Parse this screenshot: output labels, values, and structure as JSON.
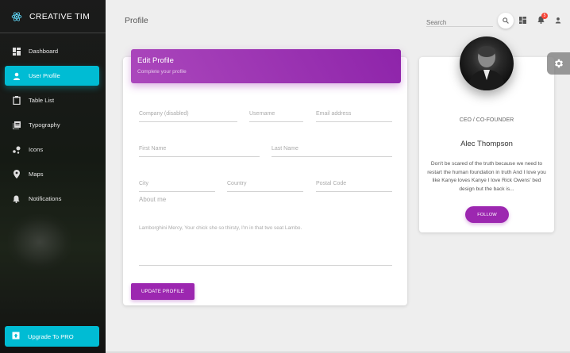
{
  "sidebar": {
    "brand": "CREATIVE TIM",
    "items": [
      {
        "label": "Dashboard",
        "icon": "dashboard-icon"
      },
      {
        "label": "User Profile",
        "icon": "person-icon",
        "active": true
      },
      {
        "label": "Table List",
        "icon": "clipboard-icon"
      },
      {
        "label": "Typography",
        "icon": "library-books-icon"
      },
      {
        "label": "Icons",
        "icon": "bubble-chart-icon"
      },
      {
        "label": "Maps",
        "icon": "location-pin-icon"
      },
      {
        "label": "Notifications",
        "icon": "bell-icon"
      }
    ],
    "upgrade_label": "Upgrade To PRO"
  },
  "topbar": {
    "title": "Profile",
    "search_placeholder": "Search",
    "notification_count": "5"
  },
  "edit_profile": {
    "title": "Edit Profile",
    "subtitle": "Complete your profile",
    "fields": {
      "company": "Company (disabled)",
      "username": "Username",
      "email": "Email address",
      "first_name": "First Name",
      "last_name": "Last Name",
      "city": "City",
      "country": "Country",
      "postal_code": "Postal Code"
    },
    "about_label": "About me",
    "about_text": "Lamborghini Mercy, Your chick she so thirsty, I'm in that two seat Lambo.",
    "update_button": "UPDATE PROFILE"
  },
  "profile_card": {
    "role": "CEO / CO-FOUNDER",
    "name": "Alec Thompson",
    "bio": "Don't be scared of the truth because we need to restart the human foundation in truth And I love you like Kanye loves Kanye I love Rick Owens' bed design but the back is...",
    "follow_button": "FOLLOW"
  },
  "colors": {
    "accent_cyan": "#00bcd4",
    "accent_purple": "#9c27b0",
    "badge_red": "#f44336"
  }
}
